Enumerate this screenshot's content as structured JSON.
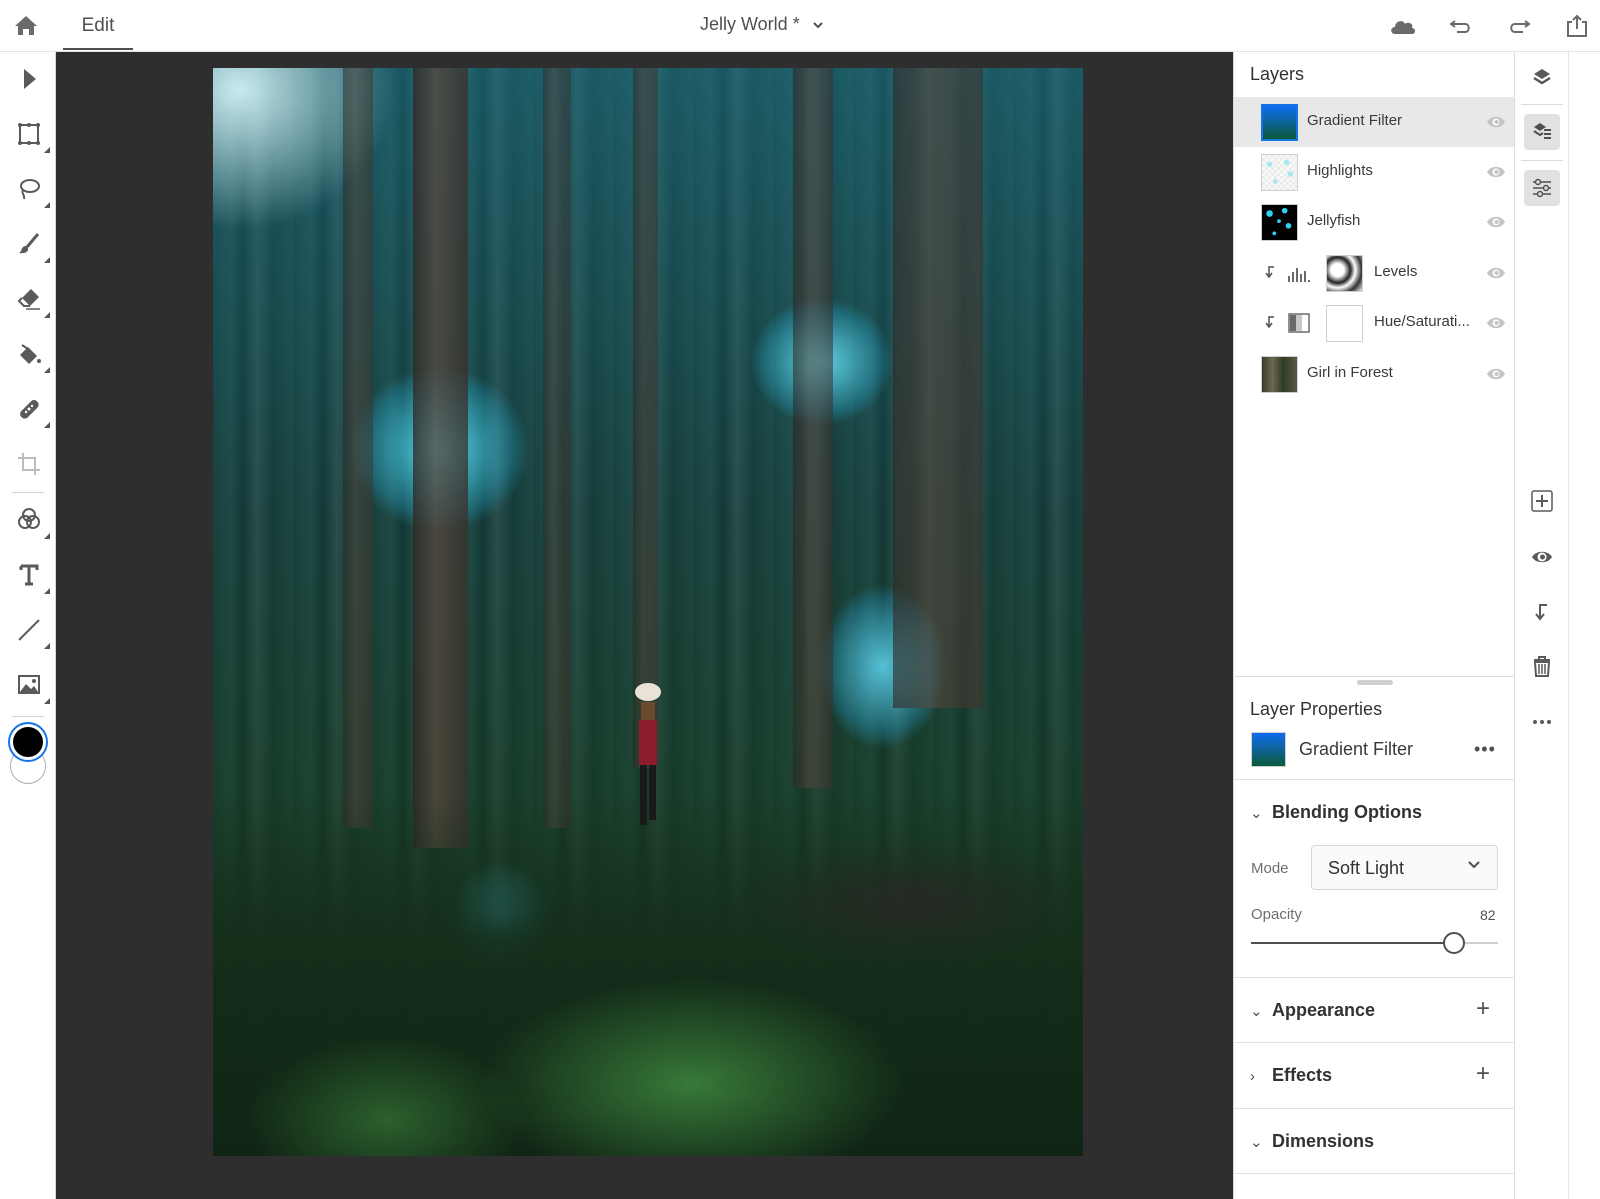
{
  "topbar": {
    "home_icon": "home-icon",
    "tab_edit": "Edit",
    "document_title": "Jelly World *",
    "icons": [
      "cloud-icon",
      "undo-icon",
      "redo-icon",
      "share-icon"
    ]
  },
  "toolbar": {
    "tools": [
      "select-tool",
      "transform-tool",
      "lasso-tool",
      "brush-tool",
      "eraser-tool",
      "fill-tool",
      "healing-tool",
      "crop-tool",
      "adjustment-tool",
      "type-tool",
      "line-tool",
      "place-image-tool"
    ],
    "foreground_color": "#000000",
    "background_color": "#ffffff"
  },
  "layers": {
    "title": "Layers",
    "items": [
      {
        "name": "Gradient Filter",
        "selected": true
      },
      {
        "name": "Highlights"
      },
      {
        "name": "Jellyfish"
      },
      {
        "name": "Levels",
        "clipped": true,
        "adjustment": "levels"
      },
      {
        "name": "Hue/Saturati...",
        "clipped": true,
        "adjustment": "hue-saturation"
      },
      {
        "name": "Girl in Forest"
      }
    ]
  },
  "rail": {
    "top": [
      "layers-icon",
      "layers-detail-icon",
      "adjustments-icon"
    ],
    "bottom": [
      "add-layer-icon",
      "visibility-icon",
      "clip-icon",
      "delete-icon",
      "more-icon"
    ]
  },
  "properties": {
    "title": "Layer Properties",
    "layer_name": "Gradient Filter",
    "more": "•••",
    "blending": {
      "title": "Blending Options",
      "mode_label": "Mode",
      "mode_value": "Soft Light",
      "opacity_label": "Opacity",
      "opacity_value": "82",
      "opacity_fraction": 0.82
    },
    "sections": {
      "appearance": "Appearance",
      "effects": "Effects",
      "dimensions": "Dimensions"
    }
  },
  "colors": {
    "accent": "#1473e6",
    "canvas_bg": "#2e2e2e"
  }
}
